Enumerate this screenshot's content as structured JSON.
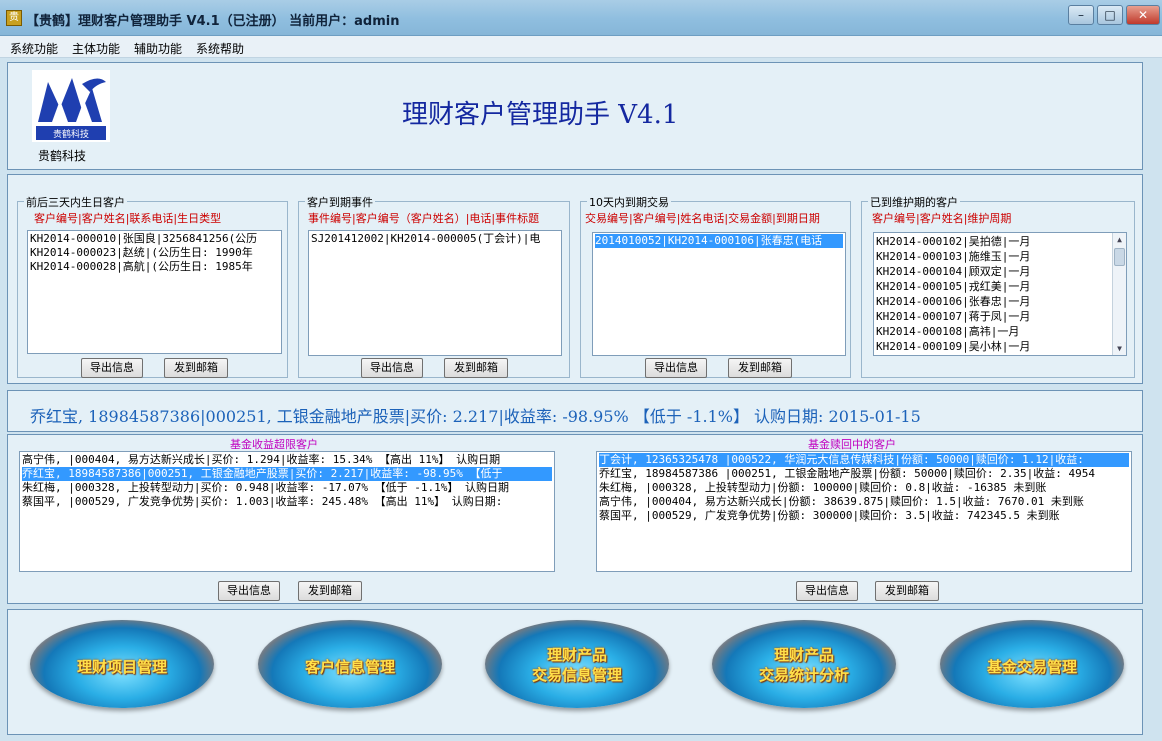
{
  "window": {
    "title": "【贵鹤】理财客户管理助手 V4.1（已注册） 当前用户：admin",
    "min_glyph": "–",
    "max_glyph": "□",
    "close_glyph": "✕"
  },
  "menu": [
    "系统功能",
    "主体功能",
    "辅助功能",
    "系统帮助"
  ],
  "header": {
    "logo_text": "贵鹤科技",
    "logo_caption": "贵鹤科技",
    "app_title": "理财客户管理助手 V4.1"
  },
  "birthday": {
    "title": "前后三天内生日客户",
    "columns": "客户编号|客户姓名|联系电话|生日类型",
    "rows": [
      "KH2014-000010|张国良|3256841256(公历",
      "KH2014-000023|赵统|(公历生日: 1990年",
      "KH2014-000028|高航|(公历生日: 1985年"
    ]
  },
  "events": {
    "title": "客户到期事件",
    "columns": "事件编号|客户编号（客户姓名）|电话|事件标题",
    "rows": [
      "SJ201412002|KH2014-000005(丁会计)|电"
    ]
  },
  "trades": {
    "title": "10天内到期交易",
    "columns": "交易编号|客户编号|姓名电话|交易金额|到期日期",
    "rows": [
      "2014010052|KH2014-000106|张春忠(电话"
    ]
  },
  "maintenance": {
    "title": "已到维护期的客户",
    "columns": "客户编号|客户姓名|维护周期",
    "rows": [
      "KH2014-000102|吴拍德|一月",
      "KH2014-000103|施维玉|一月",
      "KH2014-000104|顾双定|一月",
      "KH2014-000105|戎红美|一月",
      "KH2014-000106|张春忠|一月",
      "KH2014-000107|蒋于凤|一月",
      "KH2014-000108|高祎|一月",
      "KH2014-000109|吴小林|一月"
    ]
  },
  "buttons": {
    "export": "导出信息",
    "email": "发到邮箱"
  },
  "info_line": "乔红宝, 18984587386|000251, 工银金融地产股票|买价: 2.217|收益率: -98.95% 【低于 -1.1%】 认购日期: 2015-01-15",
  "fund_over": {
    "title": "基金收益超限客户",
    "rows": [
      "高宁伟, |000404, 易方达新兴成长|买价: 1.294|收益率: 15.34% 【高出 11%】 认购日期",
      "乔红宝, 18984587386|000251, 工银金融地产股票|买价: 2.217|收益率: -98.95% 【低于",
      "朱红梅, |000328, 上投转型动力|买价: 0.948|收益率: -17.07% 【低于 -1.1%】 认购日期",
      "蔡国平, |000529, 广发竞争优势|买价: 1.003|收益率: 245.48% 【高出 11%】 认购日期:"
    ]
  },
  "fund_redeem": {
    "title": "基金赎回中的客户",
    "rows": [
      "丁会计, 12365325478 |000522, 华润元大信息传媒科技|份额: 50000|赎回价: 1.12|收益:",
      "乔红宝, 18984587386 |000251, 工银金融地产股票|份额: 50000|赎回价: 2.35|收益: 4954",
      "朱红梅, |000328, 上投转型动力|份额: 100000|赎回价: 0.8|收益: -16385 未到账",
      "高宁伟, |000404, 易方达新兴成长|份额: 38639.875|赎回价: 1.5|收益: 7670.01 未到账",
      "蔡国平, |000529, 广发竞争优势|份额: 300000|赎回价: 3.5|收益: 742345.5 未到账"
    ]
  },
  "nav": {
    "projects": "理财项目管理",
    "customers": "客户信息管理",
    "trade_info_1": "理财产品",
    "trade_info_2": "交易信息管理",
    "trade_stats_1": "理财产品",
    "trade_stats_2": "交易统计分析",
    "fund_trade": "基金交易管理"
  },
  "colors": {
    "heading": "#1428a0",
    "info_line": "#1c62b9",
    "column_header": "#cc0000",
    "fund_title": "#c000c0",
    "selection": "#3399ff",
    "orb_label": "#ffe04a"
  }
}
